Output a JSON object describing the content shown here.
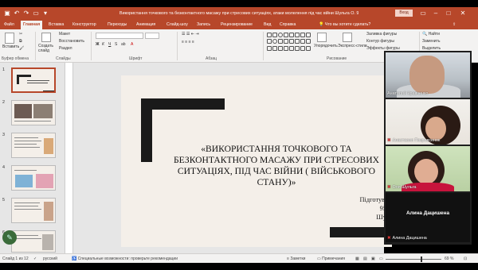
{
  "titlebar": {
    "title": "Використання точкового та безконтактного масажу при стресових ситуаціях, атаки молелення під час війни Шульга О. 957 - PowerPoint",
    "signin": "Вход"
  },
  "menu": {
    "tabs": [
      "Файл",
      "Главная",
      "Вставка",
      "Конструктор",
      "Переходы",
      "Анимация",
      "Слайд-шоу",
      "Запись",
      "Рецензирование",
      "Вид",
      "Справка"
    ],
    "tellme": "Что вы хотите сделать?"
  },
  "ribbon": {
    "paste": "Вставить",
    "cut": "Макет",
    "restore": "Восстановить",
    "section": "Раздел",
    "new_slide": "Создать слайд",
    "arrange": "Упорядочить",
    "styles": "Экспресс-стили",
    "fill": "Заливка фигуры",
    "outline": "Контур фигуры",
    "effects": "Эффекты фигуры",
    "find": "Найти",
    "replace": "Заменить",
    "select": "Выделить",
    "groups": {
      "clipboard": "Буфер обмена",
      "slides": "Слайды",
      "font": "Шрифт",
      "paragraph": "Абзац",
      "drawing": "Рисование"
    }
  },
  "thumbnails": [
    "1",
    "2",
    "3",
    "4",
    "5",
    "6"
  ],
  "slide": {
    "title": "«Використання точкового та безконтактного масажу при стресових ситуаціях, під час війни ( військового стану)»",
    "author_lines": [
      "Підготувала студ",
      "957 групи",
      "Шульга Ол"
    ]
  },
  "call": {
    "participants": [
      {
        "name": "Анатолий Кравченко",
        "muted": false
      },
      {
        "name": "Анастасия Покровсенок",
        "muted": true
      },
      {
        "name": "Оля Шульга",
        "muted": true
      },
      {
        "name": "Алина Дацишена",
        "muted": true
      }
    ],
    "big_label": "Алина Дацишена"
  },
  "status": {
    "slide_count": "Слайд 1 из 12",
    "language": "русский",
    "accessibility": "Специальные возможности: проверьте рекомендации",
    "notes": "Заметки",
    "comments": "Примечания",
    "zoom": "69 %"
  },
  "colors": {
    "accent": "#b7472a",
    "slide_bg": "#f4efe9"
  }
}
